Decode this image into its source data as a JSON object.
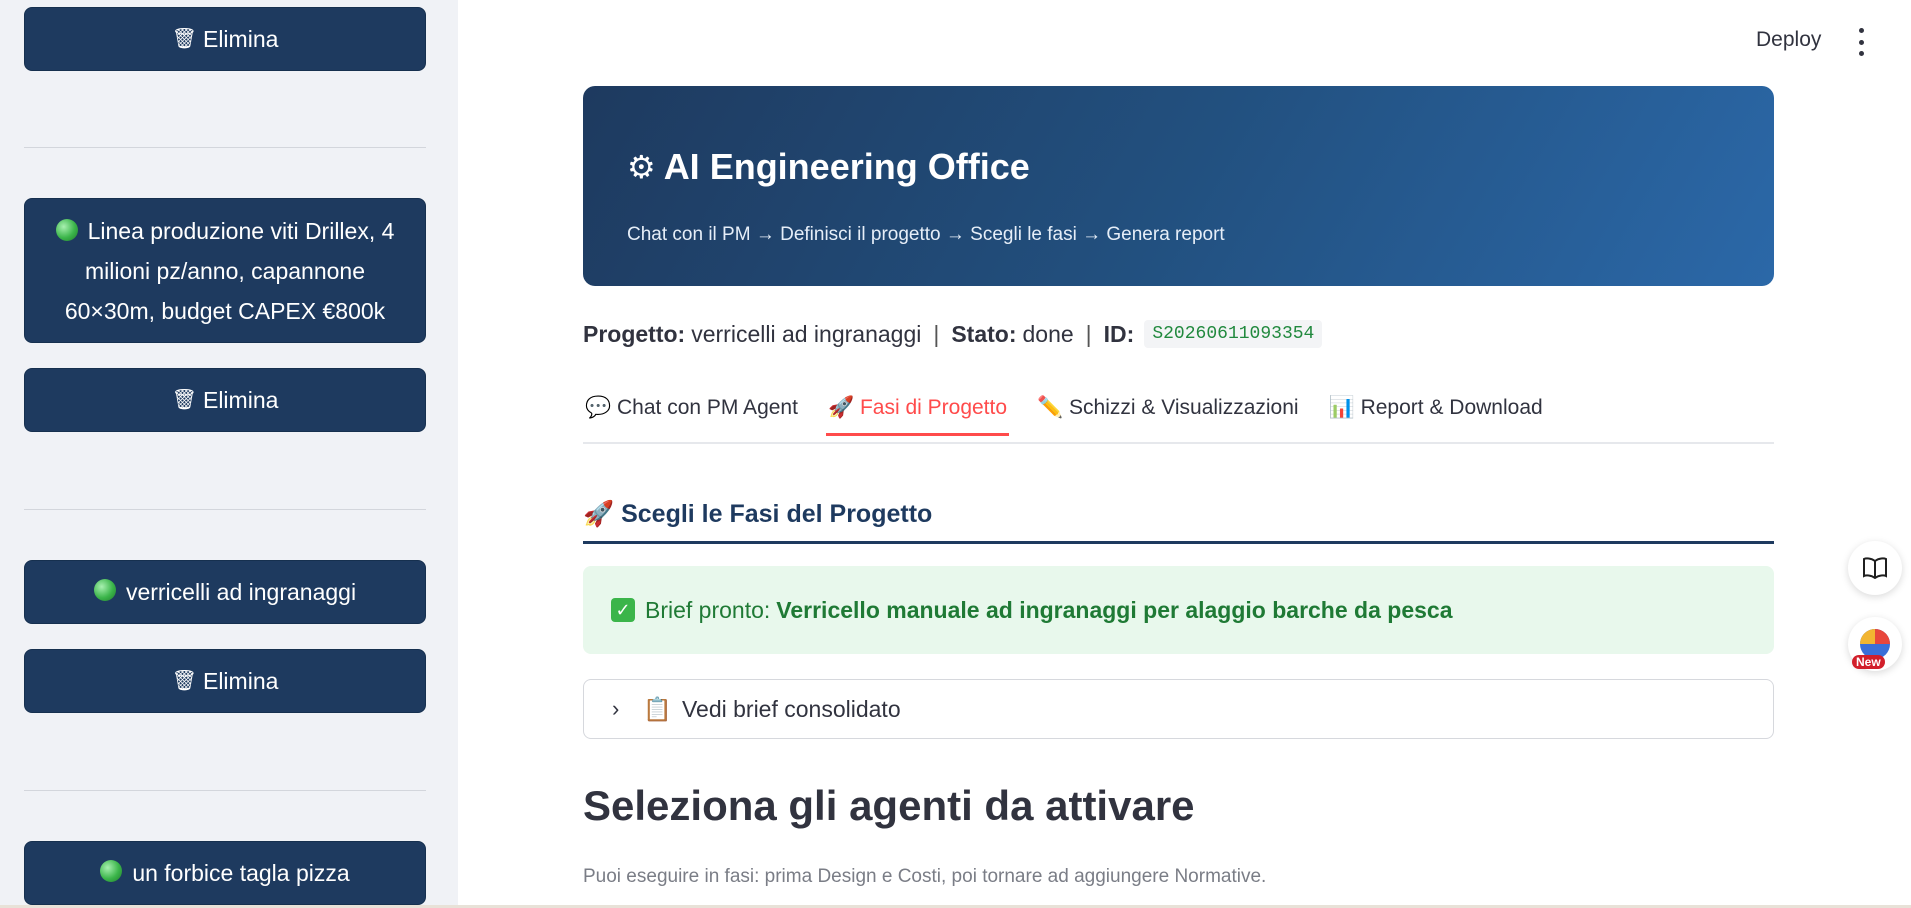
{
  "sidebar": {
    "buttons": [
      {
        "label": "Elimina",
        "kind": "delete"
      },
      {
        "label": "Linea produzione viti Drillex, 4 milioni pz/anno, capannone 60×30m, budget CAPEX €800k",
        "kind": "project"
      },
      {
        "label": "Elimina",
        "kind": "delete"
      },
      {
        "label": "verricelli ad ingranaggi",
        "kind": "project"
      },
      {
        "label": "Elimina",
        "kind": "delete"
      },
      {
        "label": "un forbice tagla pizza",
        "kind": "project"
      }
    ],
    "icons": {
      "delete": "trash-icon",
      "project": "green-circle-icon"
    }
  },
  "topbar": {
    "deploy_label": "Deploy",
    "menu_icon": "kebab-menu-icon"
  },
  "hero": {
    "icon": "⚙",
    "title": "AI Engineering Office",
    "subtitle": "Chat con il PM → Definisci il progetto → Scegli le fasi → Genera report",
    "gradient": [
      "#1e3a5f",
      "#2b68a8"
    ]
  },
  "meta": {
    "progetto_label": "Progetto:",
    "progetto_value": "verricelli ad ingranaggi",
    "stato_label": "Stato:",
    "stato_value": "done",
    "id_label": "ID:",
    "id_value": "S20260611093354"
  },
  "tabs": [
    {
      "icon": "💬",
      "label": "Chat con PM Agent",
      "active": false
    },
    {
      "icon": "🚀",
      "label": "Fasi di Progetto",
      "active": true
    },
    {
      "icon": "✏️",
      "label": "Schizzi & Visualizzazioni",
      "active": false
    },
    {
      "icon": "📊",
      "label": "Report & Download",
      "active": false
    }
  ],
  "section": {
    "icon": "🚀",
    "title": "Scegli le Fasi del Progetto"
  },
  "alert": {
    "icon": "✓",
    "prefix": "Brief pronto:",
    "text": "Verricello manuale ad ingranaggi per alaggio barche da pesca"
  },
  "expander": {
    "chevron": "›",
    "icon": "📋",
    "label": "Vedi brief consolidato"
  },
  "main": {
    "heading": "Seleziona gli agenti da attivare",
    "caption": "Puoi eseguire in fasi: prima Design e Costi, poi tornare ad aggiungere Normative."
  },
  "floating": {
    "new_badge": "New"
  },
  "colors": {
    "accent": "#ff4b4b",
    "primary": "#1e3a5f",
    "success": "#21893e"
  }
}
